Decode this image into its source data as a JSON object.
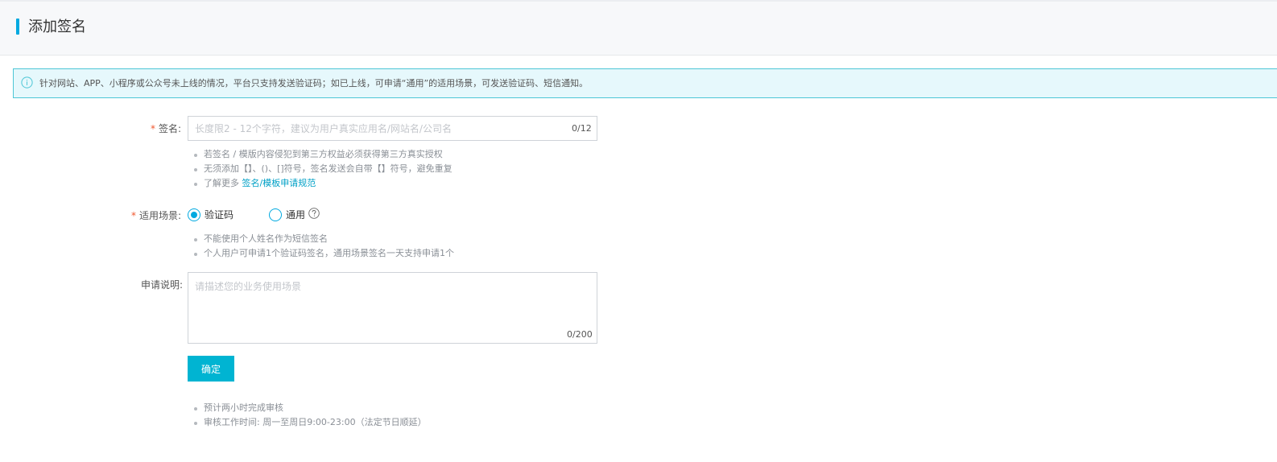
{
  "page": {
    "title": "添加签名"
  },
  "notice": {
    "icon": "info-icon",
    "text": "针对网站、APP、小程序或公众号未上线的情况，平台只支持发送验证码；如已上线，可申请“通用”的适用场景，可发送验证码、短信通知。"
  },
  "form": {
    "required_mark": "*",
    "signature": {
      "label": "签名:",
      "placeholder": "长度限2 - 12个字符，建议为用户真实应用名/网站名/公司名",
      "value": "",
      "counter": "0/12",
      "tips": [
        "若签名 / 模版内容侵犯到第三方权益必须获得第三方真实授权",
        "无须添加【】、()、[]符号，签名发送会自带【】符号，避免重复"
      ],
      "learn_more_prefix": "了解更多 ",
      "learn_more_link": "签名/模板申请规范"
    },
    "scenario": {
      "label": "适用场景:",
      "options": [
        {
          "label": "验证码",
          "checked": true
        },
        {
          "label": "通用",
          "checked": false
        }
      ],
      "help_icon": "question-circle-icon",
      "tips": [
        "不能使用个人姓名作为短信签名",
        "个人用户可申请1个验证码签名，通用场景签名一天支持申请1个"
      ]
    },
    "description": {
      "label": "申请说明:",
      "placeholder": "请描述您的业务使用场景",
      "value": "",
      "counter": "0/200"
    },
    "submit_label": "确定",
    "footer_tips": [
      "预计两小时完成审核",
      "审核工作时间: 周一至周日9:00-23:00（法定节日顺延）"
    ]
  },
  "colors": {
    "accent": "#00a9e0",
    "button": "#00b4d2",
    "required": "#f0572f",
    "notice_bg": "#e6f8fc",
    "notice_border": "#4dc6d6",
    "link": "#00a0c6"
  }
}
